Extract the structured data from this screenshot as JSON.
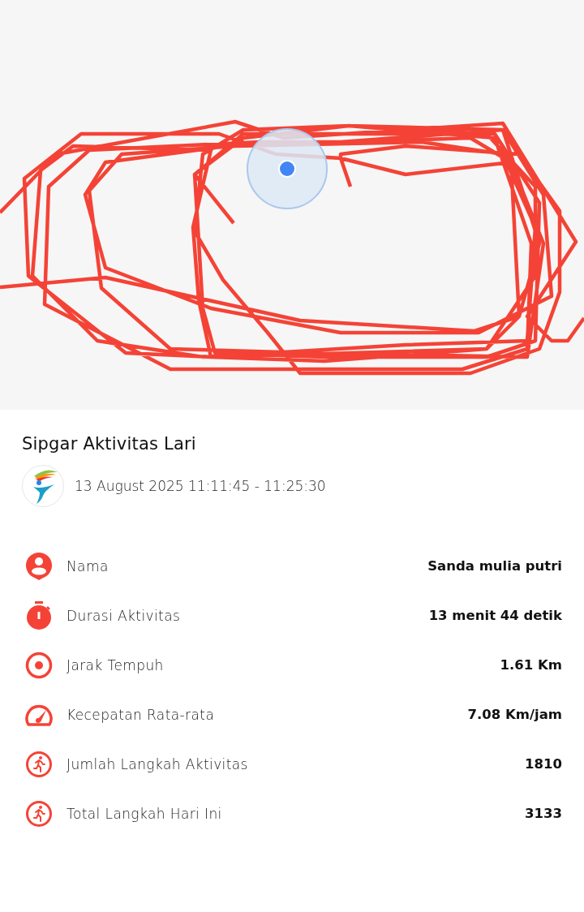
{
  "map": {
    "kind": "route"
  },
  "activity": {
    "title": "Sipgar Aktivitas Lari",
    "datetime": "13 August 2025 11:11:45 - 11:25:30"
  },
  "stats": [
    {
      "kind": "person",
      "label": "Nama",
      "value": "Sanda mulia putri"
    },
    {
      "kind": "stopwatch",
      "label": "Durasi Aktivitas",
      "value": "13 menit 44 detik"
    },
    {
      "kind": "target",
      "label": "Jarak Tempuh",
      "value": "1.61 Km"
    },
    {
      "kind": "speedometer",
      "label": "Kecepatan Rata-rata",
      "value": "7.08 Km/jam"
    },
    {
      "kind": "runner",
      "label": "Jumlah Langkah Aktivitas",
      "value": "1810"
    },
    {
      "kind": "runner",
      "label": "Total Langkah Hari Ini",
      "value": "3133"
    }
  ]
}
